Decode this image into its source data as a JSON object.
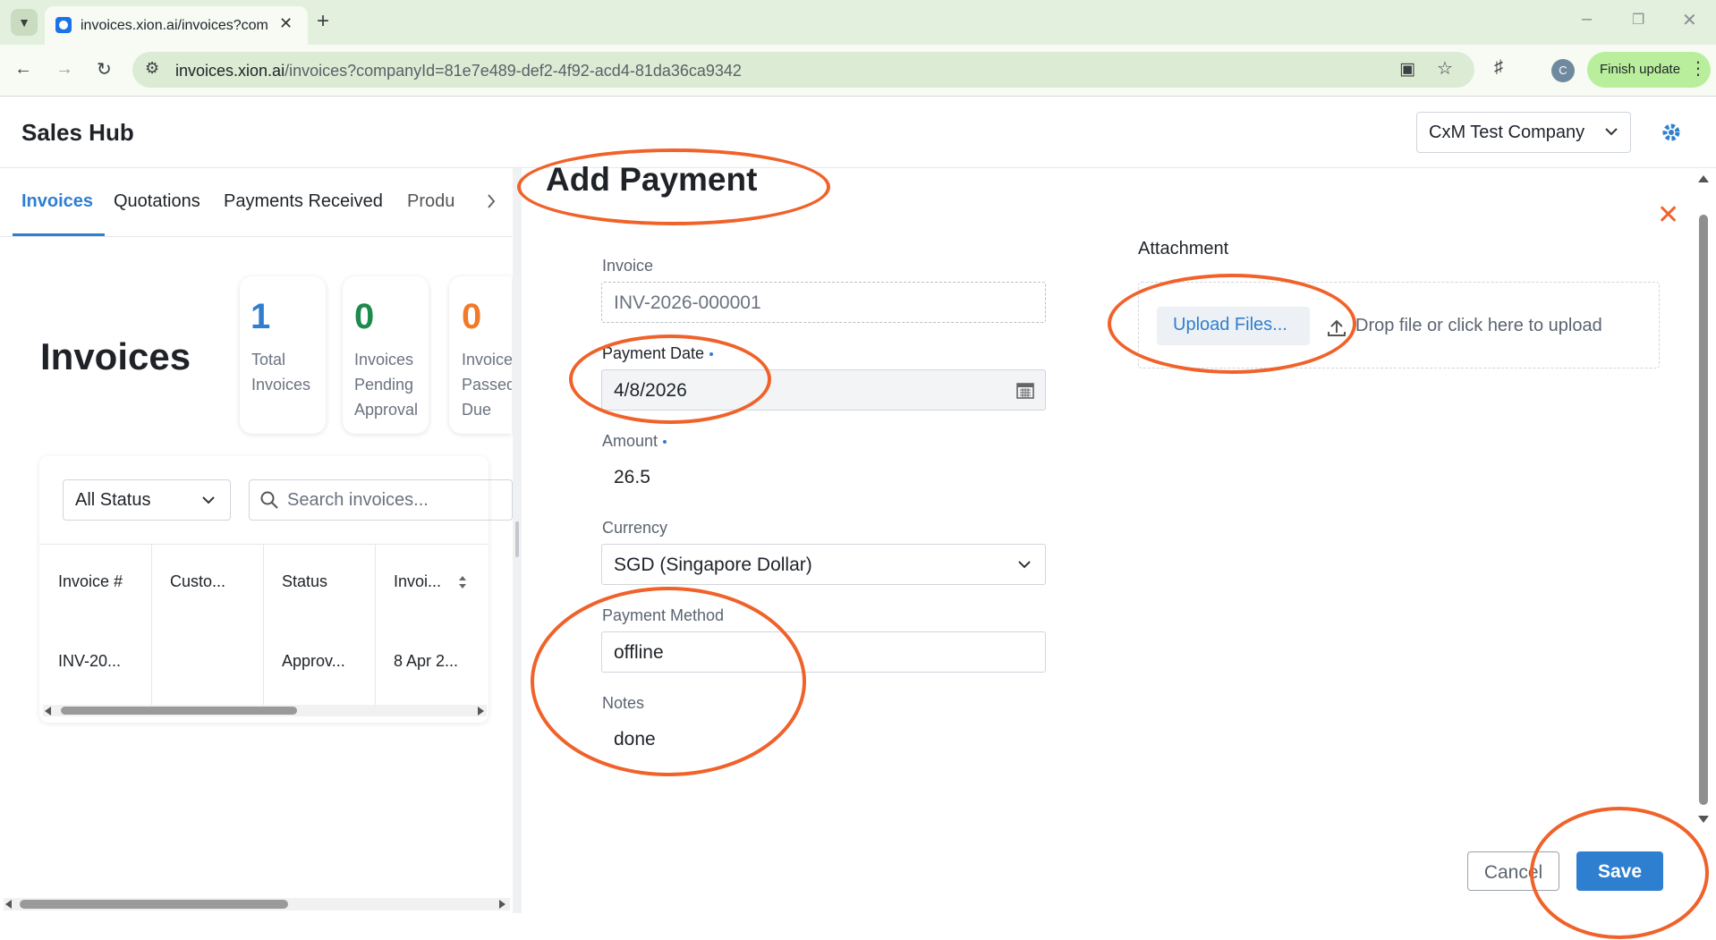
{
  "browser": {
    "tab_title": "invoices.xion.ai/invoices?compa",
    "url_host": "invoices.xion.ai",
    "url_rest": "/invoices?companyId=81e7e489-def2-4f92-acd4-81da36ca9342",
    "profile_initial": "C",
    "finish_update_label": "Finish update"
  },
  "app": {
    "title": "Sales Hub",
    "company": "CxM Test Company"
  },
  "nav": {
    "tabs": [
      "Invoices",
      "Quotations",
      "Payments Received",
      "Produ"
    ]
  },
  "page": {
    "heading": "Invoices",
    "stats": [
      {
        "value": "1",
        "label": "Total Invoices",
        "color": "#2f7fd0"
      },
      {
        "value": "0",
        "label": "Invoices Pending Approval",
        "color": "#1d8a4e"
      },
      {
        "value": "0",
        "label": "Invoices Passed Due",
        "color": "#f07a2a"
      }
    ],
    "status_filter": "All Status",
    "search_placeholder": "Search invoices...",
    "table": {
      "columns": [
        "Invoice #",
        "Custo...",
        "Status",
        "Invoi..."
      ],
      "rows": [
        [
          "INV-20...",
          "",
          "Approv...",
          "8 Apr 2..."
        ]
      ]
    }
  },
  "drawer": {
    "title": "Add Payment",
    "invoice_label": "Invoice",
    "invoice_value": "INV-2026-000001",
    "payment_date_label": "Payment Date",
    "payment_date_value": "4/8/2026",
    "amount_label": "Amount",
    "amount_value": "26.5",
    "currency_label": "Currency",
    "currency_value": "SGD (Singapore Dollar)",
    "method_label": "Payment Method",
    "method_value": "offline",
    "notes_label": "Notes",
    "notes_value": "done",
    "attachment_label": "Attachment",
    "upload_button": "Upload Files...",
    "drop_hint": "Drop file or click here to upload",
    "cancel_label": "Cancel",
    "save_label": "Save"
  },
  "colors": {
    "accent": "#2f7fd0",
    "annotation": "#f0622a"
  }
}
